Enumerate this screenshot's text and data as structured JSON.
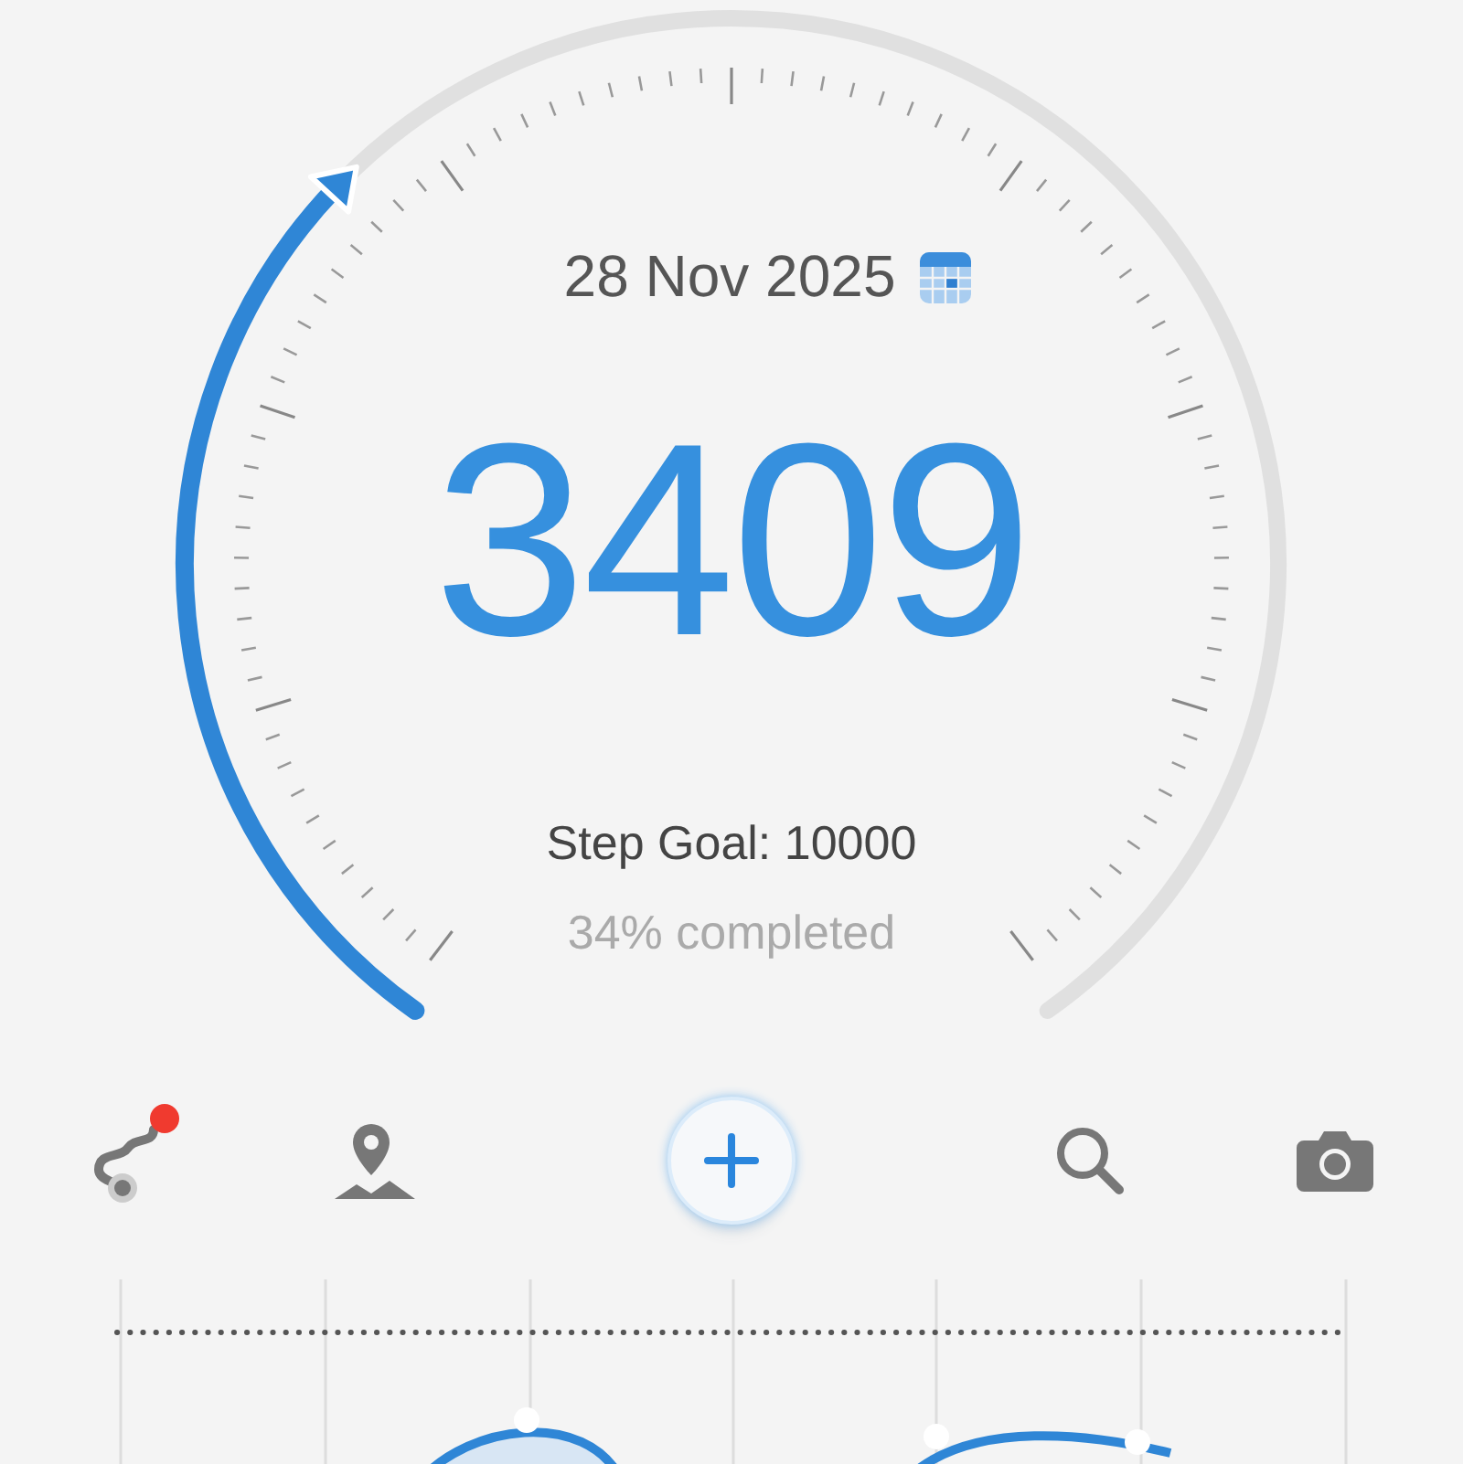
{
  "gauge": {
    "date": "28 Nov 2025",
    "steps": "3409",
    "goal": "Step Goal: 10000",
    "completed": "34% completed"
  },
  "toolbar": [
    {
      "kind": "route",
      "notification": true
    },
    {
      "kind": "place"
    },
    {
      "kind": "add"
    },
    {
      "kind": "search"
    },
    {
      "kind": "camera"
    }
  ]
}
